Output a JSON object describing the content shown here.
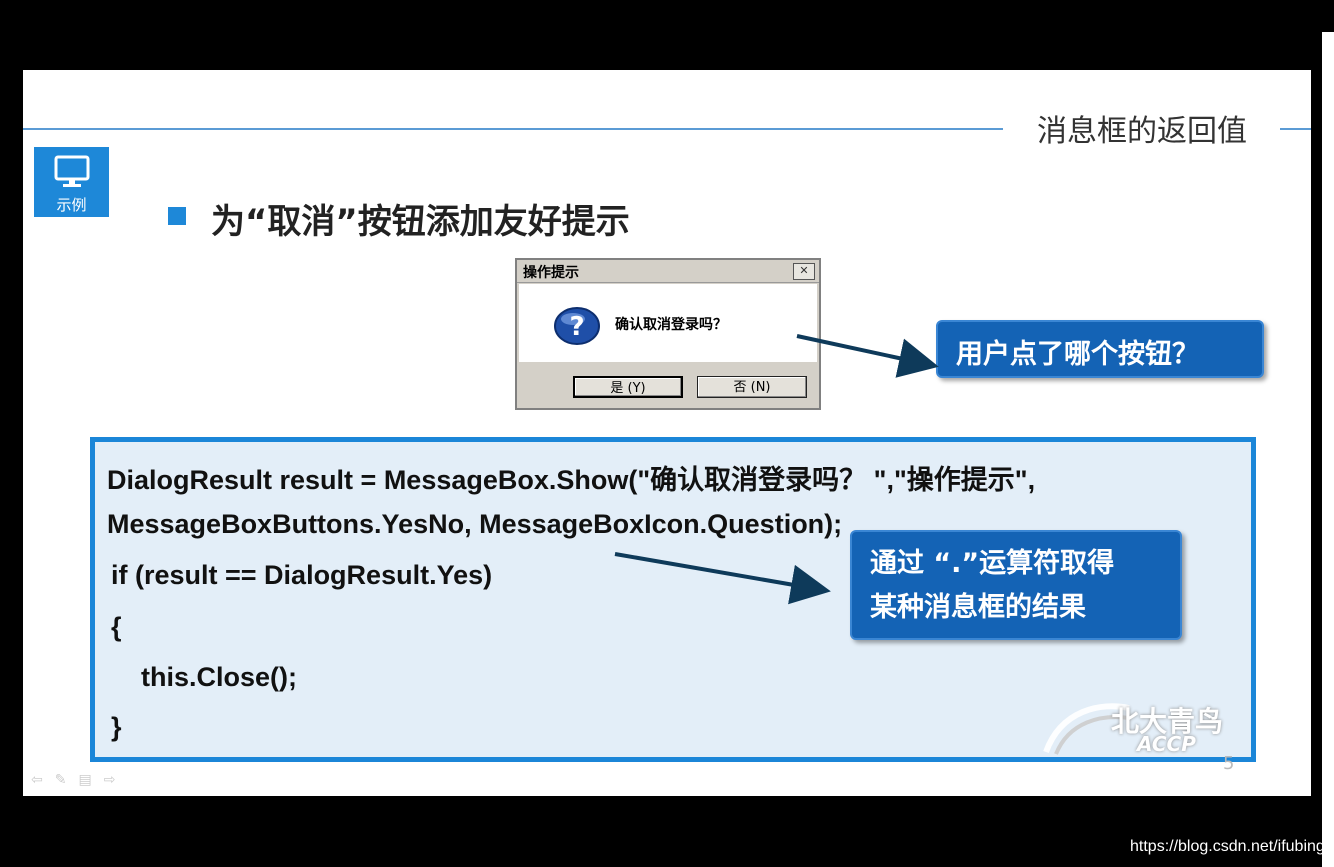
{
  "slide": {
    "title": "消息框的返回值",
    "badge_label": "示例",
    "bullet": "为“取消”按钮添加友好提示",
    "page_number": "5",
    "colors": {
      "accent": "#1e88d8",
      "callout": "#1463b5",
      "code_bg": "#e3eef8"
    }
  },
  "dialog": {
    "title": "操作提示",
    "close_glyph": "✕",
    "message": "确认取消登录吗？",
    "yes_label": "是 (Y)",
    "no_label": "否 (N)",
    "icon": "question-icon"
  },
  "callouts": {
    "button_question": "用户点了哪个按钮？",
    "dot_operator_line1": "通过 “.”运算符取得",
    "dot_operator_line2": "某种消息框的结果"
  },
  "code": {
    "line1": "DialogResult result = MessageBox.Show(\"确认取消登录吗？ \",\"操作提示\",",
    "line2": "MessageBoxButtons.YesNo, MessageBoxIcon.Question);",
    "line3": "if (result == DialogResult.Yes)",
    "line4": "{",
    "line5": "this.Close();",
    "line6": "}"
  },
  "watermark": {
    "cn": "北大青鸟",
    "en": "ACCP"
  },
  "footer": {
    "url": "https://blog.csdn.net/ifubing"
  }
}
